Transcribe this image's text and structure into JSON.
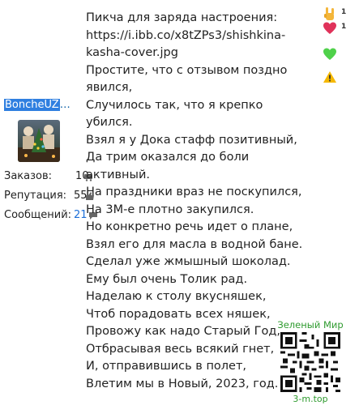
{
  "user": {
    "name_selected": "BoncheUZ",
    "name_rest": "…",
    "stats": [
      {
        "label": "Заказов:",
        "value": "10"
      },
      {
        "label": "Репутация:",
        "value": "55"
      },
      {
        "label": "Сообщений:",
        "value": "21"
      }
    ]
  },
  "post": {
    "lines": [
      "Пикча для заряда настроения:",
      "https://i.ibb.co/x8tZPs3/shishkina-",
      "kasha-cover.jpg",
      "Простите, что с отзывом поздно",
      "явился,",
      "Случилось так, что я крепко",
      "убился.",
      "Взял я у Дока стафф позитивный,",
      "Да трим оказался до боли",
      "активный.",
      "На праздники враз не поскупился,",
      "На 3М-е плотно закупился.",
      "Но конкретно речь идет о плане,",
      "Взял его для масла в водной бане.",
      "Сделал уже жмышный шоколад.",
      "Ему был очень Толик рад.",
      "Наделаю к столу вкусняшек,",
      "Чтоб порадовать всех няшек,",
      "Провожу как надо Старый Год,",
      "Отбрасывая весь всякий гнет,",
      "И, отправившись в полет,",
      "Влетим мы в Новый, 2023, год."
    ]
  },
  "reactions": [
    {
      "icon": "rock-hand-icon",
      "count": "1"
    },
    {
      "icon": "heart-icon",
      "count": "1"
    },
    {
      "icon": "green-heart-icon",
      "count": ""
    },
    {
      "icon": "warning-icon",
      "count": ""
    }
  ],
  "qr": {
    "title": "Зеленый Мир",
    "url": "3-m.top"
  },
  "colors": {
    "accent_link": "#1d6fd8",
    "selection": "#2f7fe0",
    "brand_green": "#2f9b2f"
  }
}
